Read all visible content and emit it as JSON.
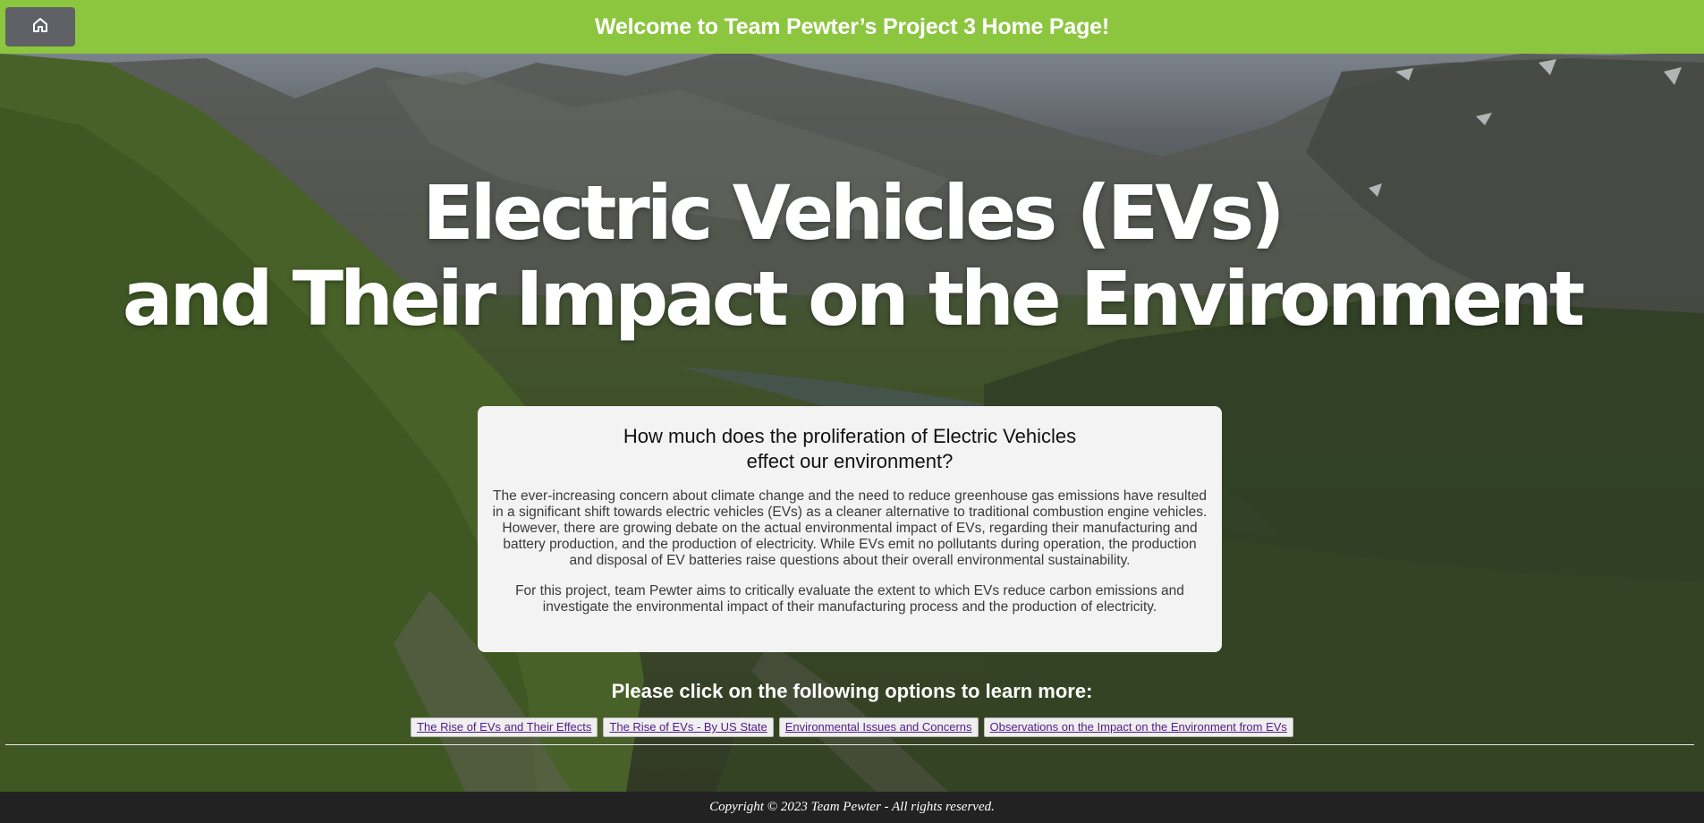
{
  "header": {
    "title": "Welcome to Team Pewter’s Project 3 Home Page!",
    "home_icon": "home-icon",
    "color": "#8cc63f"
  },
  "hero": {
    "line1": "Electric Vehicles (EVs)",
    "line2": "and Their Impact on the Environment"
  },
  "card": {
    "heading_line1": "How much does the proliferation of Electric Vehicles",
    "heading_line2": "effect our environment?",
    "paragraph1": "The ever-increasing concern about climate change and the need to reduce greenhouse gas emissions have resulted in a significant shift towards electric vehicles (EVs) as a cleaner alternative to traditional combustion engine vehicles. However, there are growing debate on the actual environmental impact of EVs, regarding their manufacturing and battery production, and the production of electricity. While EVs emit no pollutants during operation, the production and disposal of EV batteries raise questions about their overall environmental sustainability.",
    "paragraph2": "For this project, team Pewter aims to critically evaluate the extent to which EVs reduce carbon emissions and investigate the environmental impact of their manufacturing process and the production of electricity."
  },
  "learn_more": {
    "prompt": "Please click on the following options to learn more:",
    "links": [
      "The Rise of EVs and Their Effects",
      "The Rise of EVs - By US State",
      "Environmental Issues and Concerns",
      "Observations on the Impact on the Environment from EVs"
    ]
  },
  "footer": {
    "text": "Copyright © 2023 Team Pewter - All rights reserved."
  }
}
